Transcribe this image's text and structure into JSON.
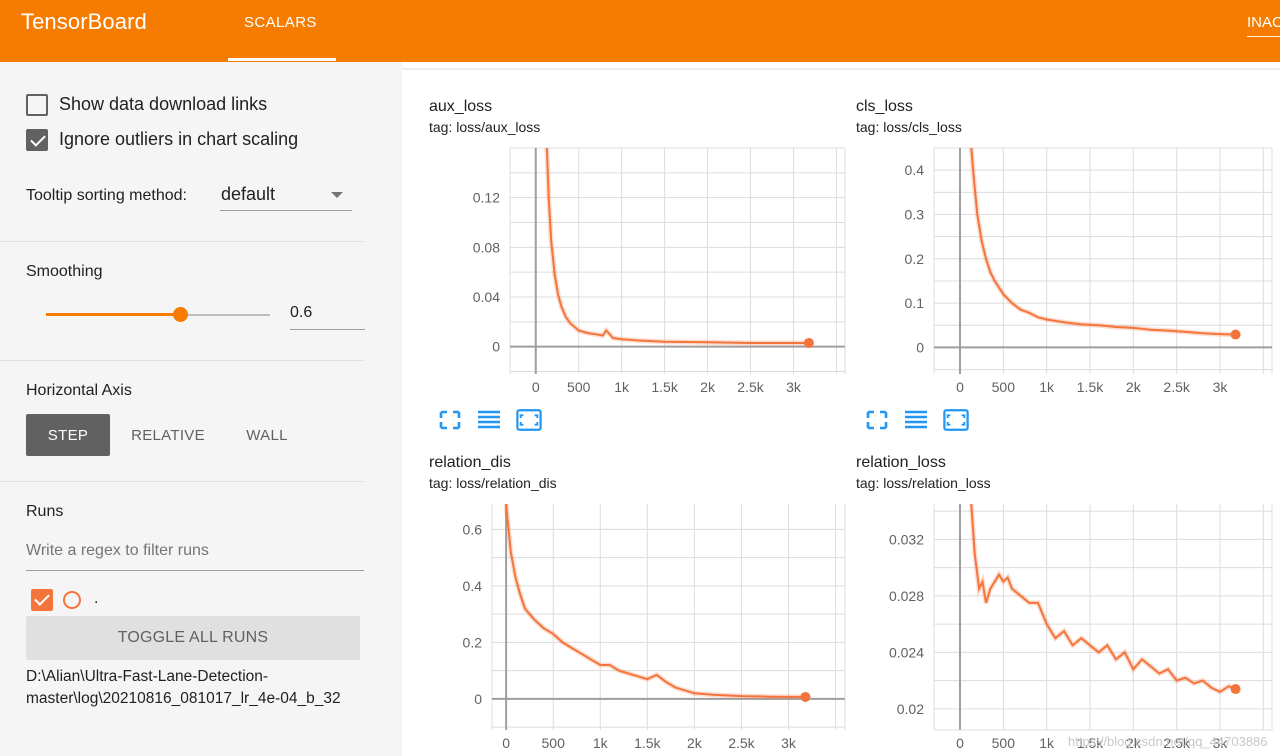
{
  "app": {
    "brand": "TensorBoard",
    "tabs": [
      {
        "label": "SCALARS",
        "active": true
      },
      {
        "label": "INAC",
        "active": false
      }
    ],
    "accent_color": "#f57c00",
    "series_color": "#f4753c"
  },
  "sidebar": {
    "show_download_links": {
      "label": "Show data download links",
      "checked": false
    },
    "ignore_outliers": {
      "label": "Ignore outliers in chart scaling",
      "checked": true
    },
    "tooltip_sorting": {
      "label": "Tooltip sorting method:",
      "value": "default"
    },
    "smoothing": {
      "label": "Smoothing",
      "value": "0.6",
      "fraction": 0.6
    },
    "horizontal_axis": {
      "label": "Horizontal Axis",
      "options": [
        "STEP",
        "RELATIVE",
        "WALL"
      ],
      "selected": "STEP"
    },
    "runs": {
      "label": "Runs",
      "filter_placeholder": "Write a regex to filter runs",
      "run_name": ".",
      "toggle_all_label": "TOGGLE ALL RUNS",
      "run_path": "D:\\Alian\\Ultra-Fast-Lane-Detection-master\\log\\20210816_081017_lr_4e-04_b_32"
    }
  },
  "watermark": "https://blog.csdn.net/qq_44703886",
  "chart_data": [
    {
      "type": "line",
      "title": "aux_loss",
      "tag": "tag: loss/aux_loss",
      "x_ticks": [
        "0",
        "500",
        "1k",
        "1.5k",
        "2k",
        "2.5k",
        "3k"
      ],
      "y_ticks": [
        "0",
        "0.04",
        "0.08",
        "0.12"
      ],
      "xlim": [
        -300,
        3600
      ],
      "ylim": [
        -0.022,
        0.16
      ],
      "series": [
        {
          "x": [
            130,
            150,
            180,
            220,
            260,
            300,
            350,
            400,
            500,
            600,
            700,
            780,
            820,
            900,
            1000,
            1200,
            1500,
            2000,
            2500,
            3000,
            3180
          ],
          "y": [
            0.16,
            0.12,
            0.085,
            0.058,
            0.042,
            0.032,
            0.024,
            0.019,
            0.013,
            0.011,
            0.01,
            0.009,
            0.013,
            0.007,
            0.006,
            0.005,
            0.004,
            0.0035,
            0.003,
            0.003,
            0.003
          ]
        }
      ]
    },
    {
      "type": "line",
      "title": "cls_loss",
      "tag": "tag: loss/cls_loss",
      "x_ticks": [
        "0",
        "500",
        "1k",
        "1.5k",
        "2k",
        "2.5k",
        "3k"
      ],
      "y_ticks": [
        "0",
        "0.1",
        "0.2",
        "0.3",
        "0.4"
      ],
      "xlim": [
        -300,
        3600
      ],
      "ylim": [
        -0.06,
        0.45
      ],
      "series": [
        {
          "x": [
            130,
            160,
            200,
            250,
            300,
            350,
            400,
            500,
            600,
            700,
            800,
            900,
            1000,
            1200,
            1400,
            1600,
            1800,
            2000,
            2200,
            2400,
            2600,
            2800,
            3000,
            3180
          ],
          "y": [
            0.45,
            0.38,
            0.3,
            0.24,
            0.2,
            0.17,
            0.15,
            0.12,
            0.1,
            0.085,
            0.078,
            0.068,
            0.063,
            0.057,
            0.052,
            0.05,
            0.046,
            0.044,
            0.04,
            0.038,
            0.035,
            0.032,
            0.03,
            0.029
          ]
        }
      ]
    },
    {
      "type": "line",
      "title": "relation_dis",
      "tag": "tag: loss/relation_dis",
      "x_ticks": [
        "0",
        "500",
        "1k",
        "1.5k",
        "2k",
        "2.5k",
        "3k"
      ],
      "y_ticks": [
        "0",
        "0.2",
        "0.4",
        "0.6"
      ],
      "xlim": [
        -150,
        3600
      ],
      "ylim": [
        -0.11,
        0.69
      ],
      "series": [
        {
          "x": [
            0,
            20,
            50,
            100,
            150,
            200,
            300,
            400,
            500,
            600,
            700,
            800,
            900,
            1000,
            1100,
            1200,
            1300,
            1400,
            1500,
            1600,
            1700,
            1800,
            2000,
            2200,
            2500,
            2800,
            3000,
            3180
          ],
          "y": [
            0.69,
            0.62,
            0.52,
            0.43,
            0.37,
            0.32,
            0.28,
            0.25,
            0.23,
            0.2,
            0.18,
            0.16,
            0.14,
            0.12,
            0.12,
            0.1,
            0.09,
            0.08,
            0.07,
            0.085,
            0.06,
            0.04,
            0.02,
            0.015,
            0.01,
            0.008,
            0.007,
            0.007
          ]
        }
      ]
    },
    {
      "type": "line",
      "title": "relation_loss",
      "tag": "tag: loss/relation_loss",
      "x_ticks": [
        "0",
        "500",
        "1k",
        "1.5k",
        "2k",
        "2.5k",
        "3k"
      ],
      "y_ticks": [
        "0.02",
        "0.024",
        "0.028",
        "0.032"
      ],
      "xlim": [
        -300,
        3600
      ],
      "ylim": [
        0.0185,
        0.0345
      ],
      "series": [
        {
          "x": [
            130,
            170,
            220,
            260,
            300,
            350,
            400,
            450,
            500,
            550,
            600,
            700,
            800,
            900,
            1000,
            1100,
            1200,
            1300,
            1400,
            1500,
            1600,
            1700,
            1800,
            1900,
            2000,
            2100,
            2200,
            2300,
            2400,
            2500,
            2600,
            2700,
            2800,
            2900,
            3000,
            3100,
            3180
          ],
          "y": [
            0.0345,
            0.031,
            0.0285,
            0.029,
            0.0275,
            0.0285,
            0.029,
            0.0295,
            0.029,
            0.0293,
            0.0285,
            0.028,
            0.0275,
            0.0275,
            0.026,
            0.025,
            0.0255,
            0.0245,
            0.025,
            0.0245,
            0.024,
            0.0245,
            0.0235,
            0.024,
            0.0228,
            0.0235,
            0.023,
            0.0225,
            0.0228,
            0.022,
            0.0222,
            0.0218,
            0.022,
            0.0215,
            0.0212,
            0.0216,
            0.0214
          ]
        }
      ]
    }
  ]
}
